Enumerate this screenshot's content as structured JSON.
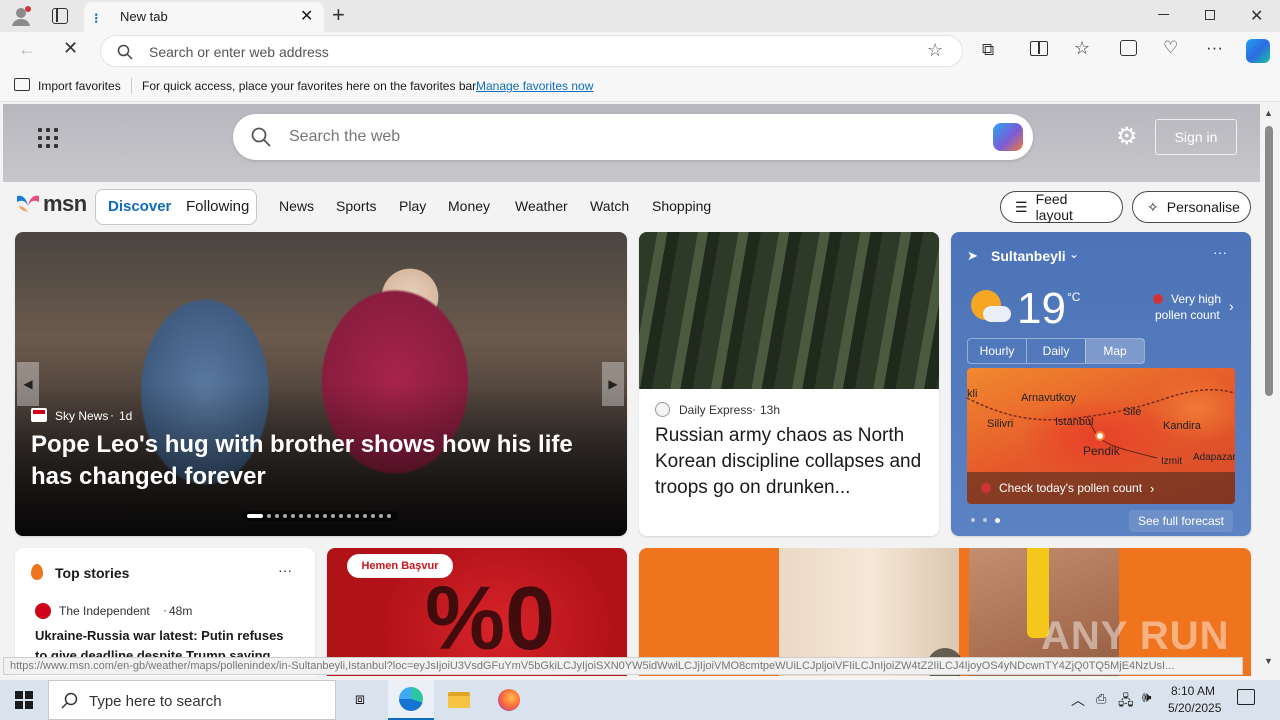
{
  "browser": {
    "tab_title": "New tab",
    "address_placeholder": "Search or enter web address",
    "import_favorites": "Import favorites",
    "favbar_message": "For quick access, place your favorites here on the favorites bar.",
    "manage_favorites": "Manage favorites now"
  },
  "msn": {
    "search_placeholder": "Search the web",
    "sign_in": "Sign in",
    "logo": "msn",
    "tabs": [
      "Discover",
      "Following"
    ],
    "nav": [
      "News",
      "Sports",
      "Play",
      "Money",
      "Weather",
      "Watch",
      "Shopping"
    ],
    "feed_layout": "Feed layout",
    "personalise": "Personalise"
  },
  "hero": {
    "source": "Sky News",
    "age": "1d",
    "headline": "Pope Leo's hug with brother shows how his life has changed forever"
  },
  "story2": {
    "source": "Daily Express",
    "age": "13h",
    "headline": "Russian army chaos as North Korean discipline collapses and troops go on drunken..."
  },
  "weather": {
    "location": "Sultanbeyli",
    "temp": "19",
    "unit": "°C",
    "pollen_line1": "Very high",
    "pollen_line2": "pollen count",
    "tabs": [
      "Hourly",
      "Daily",
      "Map"
    ],
    "map_labels": [
      "Arnavutkoy",
      "Sile",
      "Silivri",
      "Istanbul",
      "Kandira",
      "Pendik",
      "Izmit",
      "Adapazari",
      "kli"
    ],
    "pollen_check": "Check today's pollen count",
    "full_forecast": "See full forecast"
  },
  "top_stories": {
    "title": "Top stories",
    "source": "The Independent",
    "age": "48m",
    "headline": "Ukraine-Russia war latest: Putin refuses to give deadline despite Trump saying..."
  },
  "ad": {
    "badge": "Hemen Başvur",
    "big_text": "%0"
  },
  "watermark": "ANY RUN",
  "status_url": "https://www.msn.com/en-gb/weather/maps/pollenindex/in-Sultanbeyli,Istanbul?loc=eyJsIjoiU3VsdGFuYmV5bGkiLCJyIjoiSXN0YW5idWwiLCJjIjoiVMO8cmtpeWUiLCJpljoiVFIiLCJnIjoiZW4tZ2IiLCJ4IjoyOS4yNDcwnTY4ZjQ0TQ5MjE4NzUsI...",
  "taskbar": {
    "search_placeholder": "Type here to search",
    "time": "8:10 AM",
    "date": "5/20/2025"
  },
  "colors": {
    "accent": "#0f6cbd",
    "weather_bg": "#4a6fb5",
    "ad_red": "#c8161d",
    "orange": "#f0731e"
  }
}
